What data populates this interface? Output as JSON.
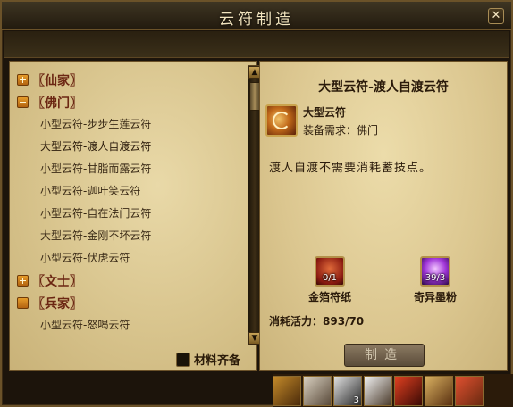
{
  "window": {
    "title": "云符制造",
    "close_label": "✕"
  },
  "tree": {
    "categories": [
      {
        "label": "〖仙家〗",
        "expanded": false,
        "items": []
      },
      {
        "label": "〖佛门〗",
        "expanded": true,
        "items": [
          "小型云符-步步生莲云符",
          "大型云符-渡人自渡云符",
          "小型云符-甘脂而露云符",
          "小型云符-迦叶笑云符",
          "小型云符-自在法门云符",
          "大型云符-金刚不坏云符",
          "小型云符-伏虎云符"
        ]
      },
      {
        "label": "〖文士〗",
        "expanded": false,
        "items": []
      },
      {
        "label": "〖兵家〗",
        "expanded": true,
        "items": [
          "小型云符-怒喝云符"
        ]
      }
    ]
  },
  "materials_checkbox_label": "材料齐备",
  "detail": {
    "title": "大型云符-渡人自渡云符",
    "type": "大型云符",
    "requirement": "装备需求：佛门",
    "description": "渡人自渡不需要消耗蓄技点。",
    "materials": [
      {
        "name": "金箔符纸",
        "count": "0/1",
        "icon": "gold-talisman-paper-icon"
      },
      {
        "name": "奇异墨粉",
        "count": "39/3",
        "icon": "strange-ink-powder-icon"
      }
    ],
    "cost": "消耗活力：893/70",
    "craft_button": "制造"
  },
  "skillbar": {
    "counts": [
      "",
      "",
      "3",
      "",
      "",
      "",
      ""
    ]
  },
  "colors": {
    "category_text": "#6b2612",
    "panel_bg": "#e9d9a8",
    "frame": "#6b5229"
  }
}
